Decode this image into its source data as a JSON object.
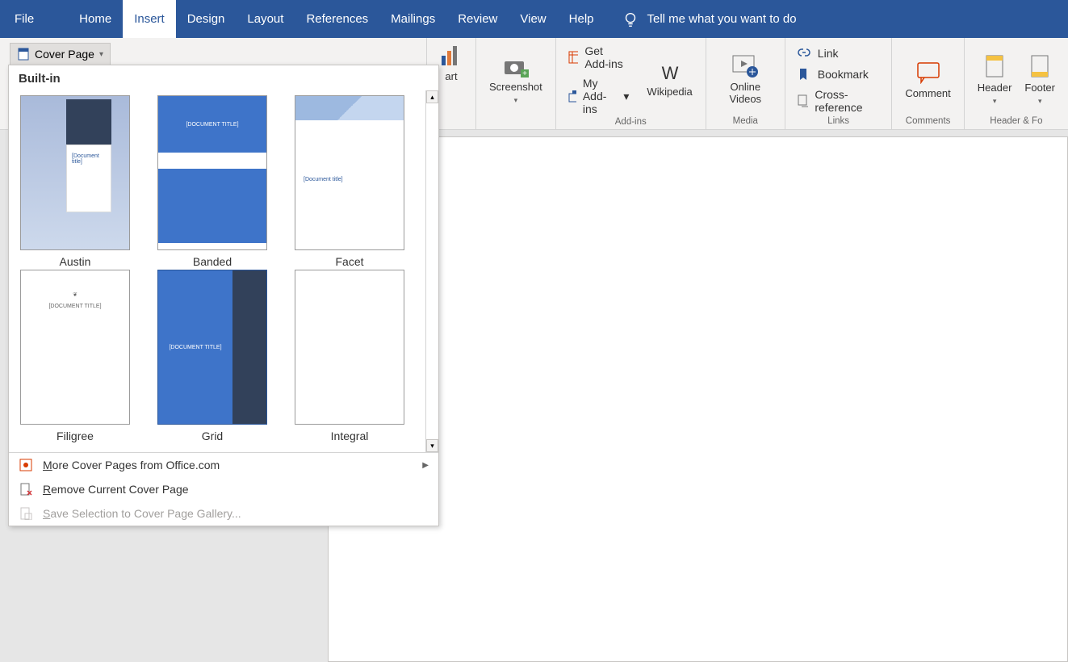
{
  "tabs": {
    "file": "File",
    "home": "Home",
    "insert": "Insert",
    "design": "Design",
    "layout": "Layout",
    "references": "References",
    "mailings": "Mailings",
    "review": "Review",
    "view": "View",
    "help": "Help"
  },
  "tellme": "Tell me what you want to do",
  "cover_page_btn": "Cover Page",
  "ribbon": {
    "art_suffix": "art",
    "screenshot": "Screenshot",
    "get_addins": "Get Add-ins",
    "my_addins": "My Add-ins",
    "wikipedia": "Wikipedia",
    "addins_group": "Add-ins",
    "online_videos": "Online Videos",
    "media_group": "Media",
    "link": "Link",
    "bookmark": "Bookmark",
    "crossref": "Cross-reference",
    "links_group": "Links",
    "comment": "Comment",
    "comments_group": "Comments",
    "header": "Header",
    "footer": "Footer",
    "headerfooter_group": "Header & Fo"
  },
  "dropdown": {
    "section": "Built-in",
    "items": [
      {
        "label": "Austin",
        "title": "[Document title]"
      },
      {
        "label": "Banded",
        "title": "[DOCUMENT TITLE]"
      },
      {
        "label": "Facet",
        "title": "[Document title]"
      },
      {
        "label": "Filigree",
        "title": "[DOCUMENT TITLE]"
      },
      {
        "label": "Grid",
        "title": "[DOCUMENT TITLE]"
      },
      {
        "label": "Integral",
        "title": ""
      }
    ],
    "more": "More Cover Pages from Office.com",
    "remove": "Remove Current Cover Page",
    "save": "Save Selection to Cover Page Gallery..."
  }
}
